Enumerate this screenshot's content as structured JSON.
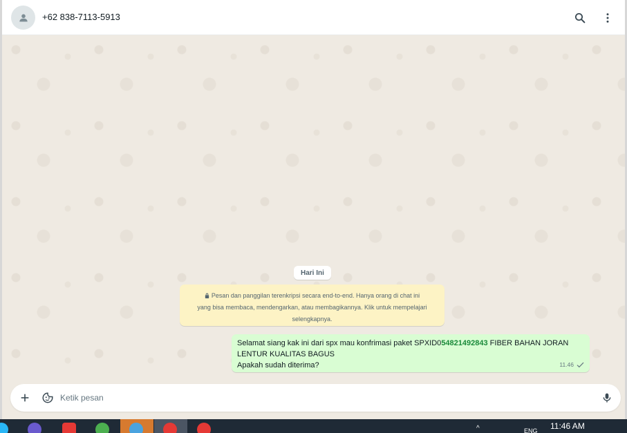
{
  "header": {
    "contact": "+62 838-7113-5913",
    "avatar_icon": "person-icon",
    "search_icon": "search-icon",
    "menu_icon": "more-vertical-icon"
  },
  "chat": {
    "date_label": "Hari Ini",
    "e2e_notice": {
      "line1": "Pesan dan panggilan terenkripsi secara end-to-end. Hanya orang di chat ini",
      "line2": "yang bisa membaca, mendengarkan, atau membagikannya. Klik untuk mempelajari",
      "line3": "selengkapnya."
    },
    "messages": [
      {
        "direction": "outgoing",
        "text_before": "Selamat siang kak ini dari spx mau konfrimasi paket SPXID0",
        "code": "54821492843",
        "text_after": " FIBER BAHAN JORAN",
        "line2": "LENTUR KUALITAS BAGUS",
        "line3": "Apakah sudah diterima?",
        "time": "11.46",
        "status_icon": "single-check-icon"
      }
    ]
  },
  "composer": {
    "placeholder": "Ketik pesan",
    "attach_icon": "plus-icon",
    "sticker_icon": "sticker-icon",
    "mic_icon": "microphone-icon"
  },
  "taskbar": {
    "time": "11:46 AM",
    "lang": "ENG"
  },
  "colors": {
    "outgoing_bubble": "#d9fdd3",
    "notice_bg": "#fdf3c5",
    "chat_bg": "#efeae2",
    "code_green": "#1a8a3a"
  }
}
